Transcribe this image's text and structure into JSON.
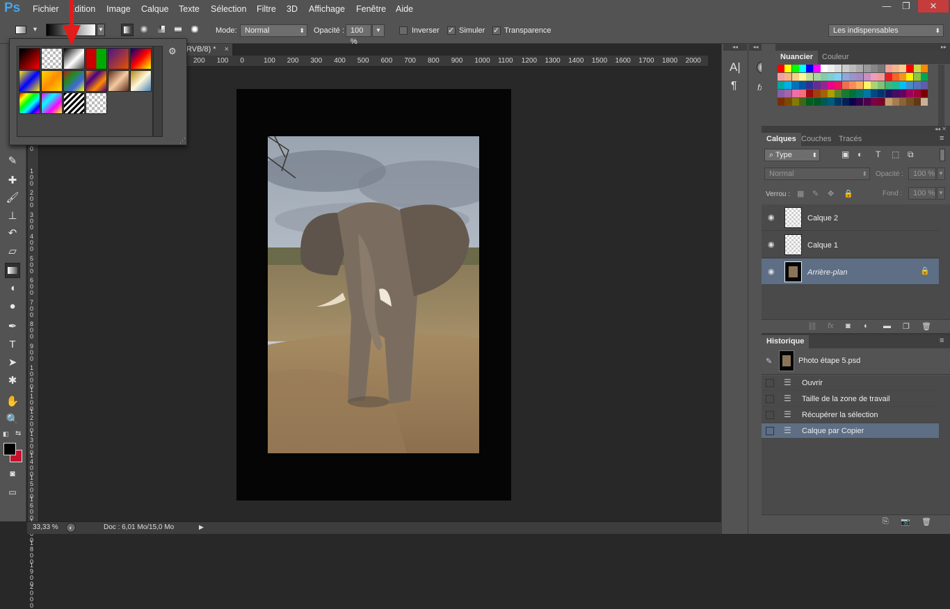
{
  "app": {
    "logo": "Ps"
  },
  "menu": [
    "Fichier",
    "Edition",
    "Image",
    "Calque",
    "Texte",
    "Sélection",
    "Filtre",
    "3D",
    "Affichage",
    "Fenêtre",
    "Aide"
  ],
  "window_buttons": [
    "—",
    "❐",
    "✕"
  ],
  "options_bar": {
    "mode_label": "Mode:",
    "mode_value": "Normal",
    "opacity_label": "Opacité :",
    "opacity_value": "100 %",
    "reverse_label": "Inverser",
    "dither_label": "Simuler",
    "dither_checked": true,
    "transparency_label": "Transparence",
    "transparency_checked": true,
    "workspace_value": "Les indispensables"
  },
  "document": {
    "tab_title": "RVB/8) *",
    "zoom": "33,33 %",
    "doc_info": "Doc : 6,01 Mo/15,0 Mo"
  },
  "ruler_h": [
    "200",
    "100",
    "0",
    "100",
    "200",
    "300",
    "400",
    "500",
    "600",
    "700",
    "800",
    "900",
    "1000",
    "1100",
    "1200",
    "1300",
    "1400",
    "1500",
    "1600",
    "1700",
    "1800",
    "2000"
  ],
  "ruler_v": [
    "0",
    "1 0 0",
    "2 0 0",
    "3 0 0",
    "4 0 0",
    "5 0 0",
    "6 0 0",
    "7 0 0",
    "8 0 0",
    "9 0 0",
    "1 0 0 0",
    "1 1 0 0",
    "1 2 0 0",
    "1 3 0 0",
    "1 4 0 0",
    "1 5 0 0",
    "1 6 0 0",
    "1 7 0 0",
    "1 8 0 0",
    "1 9 0 0",
    "2 0 0 0"
  ],
  "swatches_panel": {
    "tabs": [
      "Nuancier",
      "Couleur"
    ],
    "colors": [
      [
        "#ff0000",
        "#ffff00",
        "#00ff00",
        "#00ffff",
        "#0000ff",
        "#ff00ff",
        "#ffffff",
        "#eeeeee",
        "#dddddd",
        "#cccccc",
        "#bbbbbb",
        "#aaaaaa",
        "#999999",
        "#888888",
        "#777777",
        "#f4a09a",
        "#f6b487",
        "#f9cd8c",
        "#ff0000",
        "#ccdd44",
        "#ff8800"
      ],
      [
        "#f0a0a0",
        "#f5b385",
        "#f7d188",
        "#fff799",
        "#c3df93",
        "#a4d4a0",
        "#82cca9",
        "#7dcfd1",
        "#80d1f5",
        "#8fa7d9",
        "#9795c9",
        "#a58ac2",
        "#c78fc2",
        "#f29bb8",
        "#f29a96",
        "#ed1c24",
        "#f26522",
        "#f7941d",
        "#fff200",
        "#8dc63f",
        "#00a651"
      ],
      [
        "#00a99d",
        "#00aeef",
        "#0072bc",
        "#0054a6",
        "#2e3192",
        "#662d91",
        "#92278f",
        "#ec008c",
        "#ed145b",
        "#f26c4f",
        "#f68e55",
        "#fbaf5c",
        "#fff468",
        "#acd373",
        "#7cc576",
        "#3bb878",
        "#1abc9c",
        "#00bff3",
        "#438ccb",
        "#5674b9",
        "#605ca8"
      ],
      [
        "#8560a8",
        "#a864a8",
        "#f06eaa",
        "#f26d7d",
        "#9e0b0f",
        "#a0410d",
        "#a36209",
        "#aba000",
        "#598527",
        "#197b30",
        "#007236",
        "#00746b",
        "#0076a3",
        "#004a80",
        "#003471",
        "#1b1464",
        "#440e62",
        "#630460",
        "#9e005d",
        "#9e0039",
        "#790000"
      ],
      [
        "#7b2e00",
        "#7d4900",
        "#827b00",
        "#406618",
        "#005e20",
        "#005826",
        "#005952",
        "#005b7f",
        "#003663",
        "#002157",
        "#0d004c",
        "#32004b",
        "#4b0049",
        "#7b0046",
        "#7a0026",
        "#c69c6d",
        "#a67c52",
        "#8c6239",
        "#754c24",
        "#603913",
        "#c7b299"
      ]
    ]
  },
  "layers_panel": {
    "tabs": [
      "Calques",
      "Couches",
      "Tracés"
    ],
    "filter_value": "Type",
    "blend_value": "Normal",
    "opacity_label": "Opacité :",
    "opacity_value": "100 %",
    "lock_label": "Verrou :",
    "fill_label": "Fond :",
    "fill_value": "100 %",
    "layers": [
      {
        "name": "Calque 2",
        "selected": false
      },
      {
        "name": "Calque 1",
        "selected": false
      },
      {
        "name": "Arrière-plan",
        "selected": true
      }
    ]
  },
  "history_panel": {
    "tab": "Historique",
    "snapshot": "Photo étape 5.psd",
    "states": [
      "Ouvrir",
      "Taille de la zone de travail",
      "Récupérer la sélection",
      "Calque par Copier"
    ],
    "selected_index": 3
  },
  "gradient_popup": {
    "gradients": [
      "linear-gradient(135deg,#000 0%,#000 10%,#ff0000 100%)",
      "repeating-conic-gradient(#bbb 0% 25%,#fff 0% 50%) 0 0/8px 8px",
      "linear-gradient(135deg,#000 0%,#fff 55%,#444 100%)",
      "linear-gradient(90deg,#c00 0%,#c00 50%,#0a0 50%,#0a0 100%)",
      "linear-gradient(135deg,#4a148c,#e65100)",
      "linear-gradient(135deg,#00008b,#ff0000,#ffff00)",
      "linear-gradient(135deg,#ffeb00,#0000ff,#ffeb00)",
      "linear-gradient(135deg,#ffd700,#ff8c00,#ffd700)",
      "linear-gradient(135deg,#b22222,#228b22,#4169e1,#ff0)",
      "linear-gradient(135deg,#ff8c00,#4b0082,#ff8c00,#4b0082)",
      "linear-gradient(135deg,#5c2c1a,#f5c9a0,#5c2c1a)",
      "linear-gradient(135deg,#b8860b,#fff8dc,#4682b4)",
      "linear-gradient(135deg,#ff0000,#ffff00,#00ff00,#00ffff,#0000ff,#ff00ff)",
      "linear-gradient(135deg,#ff00ff,#00ffff,#ff00ff,#ffff00)",
      "repeating-linear-gradient(135deg,#000 0 3px,#fff 3px 6px)",
      "repeating-conic-gradient(#bbb 0% 25%,#fff 0% 50%) 0 0/8px 8px"
    ]
  }
}
